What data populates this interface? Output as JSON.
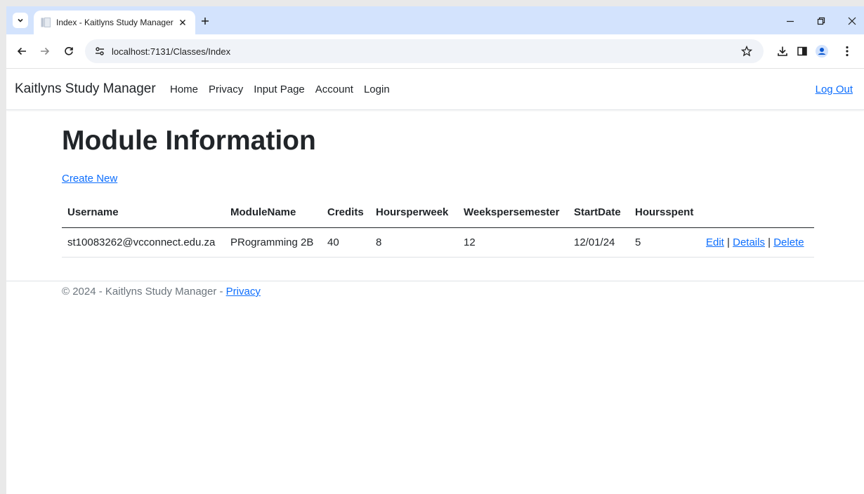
{
  "browser": {
    "tab_title": "Index - Kaitlyns Study Manager",
    "url": "localhost:7131/Classes/Index"
  },
  "navbar": {
    "brand": "Kaitlyns Study Manager",
    "links": [
      "Home",
      "Privacy",
      "Input Page",
      "Account",
      "Login"
    ],
    "logout": "Log Out"
  },
  "main": {
    "title": "Module Information",
    "create_new": "Create New",
    "columns": [
      "Username",
      "ModuleName",
      "Credits",
      "Hoursperweek",
      "Weekspersemester",
      "StartDate",
      "Hoursspent"
    ],
    "rows": [
      {
        "username": "st10083262@vcconnect.edu.za",
        "module_name": "PRogramming 2B",
        "credits": "40",
        "hours_per_week": "8",
        "weeks_per_semester": "12",
        "start_date": "12/01/24",
        "hours_spent": "5",
        "actions": {
          "edit": "Edit",
          "sep1": "|",
          "details": "Details",
          "sep2": "|",
          "delete": "Delete"
        }
      }
    ]
  },
  "footer": {
    "text": "© 2024 - Kaitlyns Study Manager - ",
    "privacy": "Privacy"
  },
  "icons": {
    "tab_search": "chevron-down-icon",
    "tab_close": "close-icon",
    "new_tab": "plus-icon",
    "back": "back-arrow-icon",
    "forward": "forward-arrow-icon",
    "reload": "reload-icon",
    "site_info": "tune-icon",
    "bookmark": "star-icon",
    "download": "download-icon",
    "side_panel": "side-panel-icon",
    "profile": "profile-icon",
    "menu": "kebab-menu-icon"
  },
  "colors": {
    "tabstrip": "#d3e3fd",
    "link": "#0d6efd",
    "omnibox": "#f0f3f8"
  }
}
